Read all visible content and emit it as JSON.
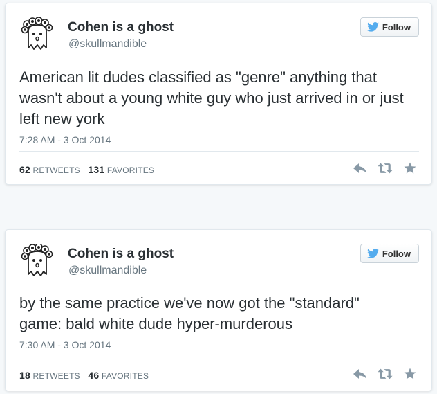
{
  "tweets": [
    {
      "display_name": "Cohen is a ghost",
      "handle": "@skullmandible",
      "follow_label": "Follow",
      "text": "American lit dudes classified as \"genre\" anything that wasn't about a young white guy who just arrived in or just left new york",
      "timestamp": "7:28 AM - 3 Oct 2014",
      "retweets_count": "62",
      "retweets_label": "RETWEETS",
      "favorites_count": "131",
      "favorites_label": "FAVORITES"
    },
    {
      "display_name": "Cohen is a ghost",
      "handle": "@skullmandible",
      "follow_label": "Follow",
      "text": "by the same practice we've now got the \"standard\" game: bald white dude hyper-murderous",
      "timestamp": "7:30 AM - 3 Oct 2014",
      "retweets_count": "18",
      "retweets_label": "RETWEETS",
      "favorites_count": "46",
      "favorites_label": "FAVORITES"
    }
  ],
  "colors": {
    "twitter_blue": "#55acee",
    "text": "#292f33",
    "muted": "#66757f",
    "action_icon": "#8899a6"
  },
  "icons": [
    "ghost-avatar",
    "twitter-bird-icon",
    "reply-icon",
    "retweet-icon",
    "favorite-star-icon"
  ]
}
